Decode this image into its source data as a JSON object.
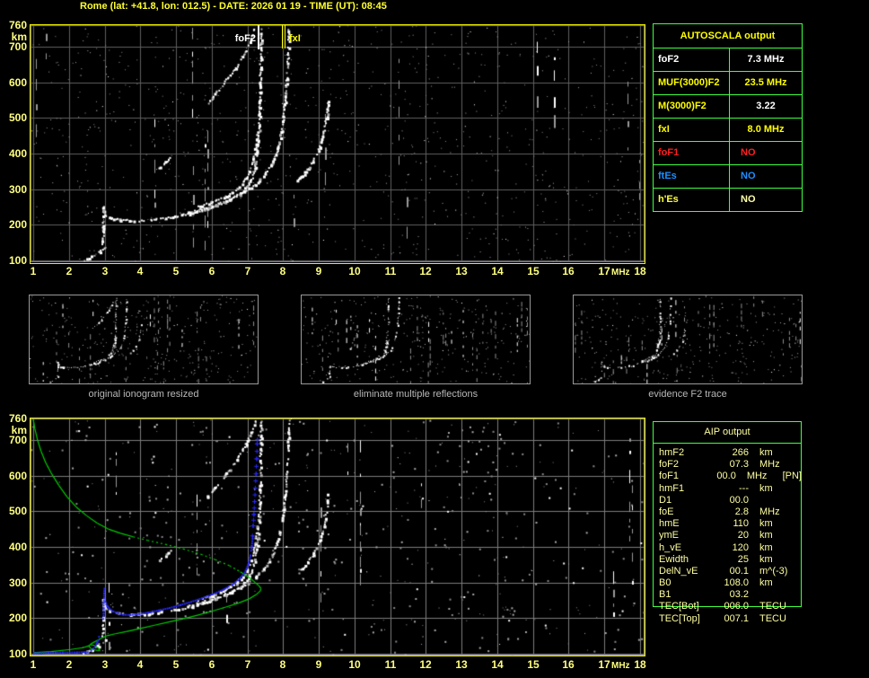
{
  "title": "Rome (lat: +41.8, lon: 012.5) - DATE: 2026 01 19 - TIME (UT): 08:45",
  "colors": {
    "plot_border": "#f0f000",
    "table_border": "#3fff3f",
    "title_text": "#ffff2e",
    "tick_text": "#ffff80",
    "trace_white": "#ffffff",
    "profile_green": "#00cc00",
    "fitted_blue": "#2828ff",
    "status_red": "#ff2020",
    "status_blue": "#1e8fff",
    "pale_yellow": "#ffffa0",
    "caption_gray": "#b8b8b8"
  },
  "top_plot": {
    "y_unit": "km",
    "x_unit": "MHz",
    "y_ticks": [
      760,
      700,
      600,
      500,
      400,
      300,
      200,
      100
    ],
    "x_ticks": [
      "1",
      "2",
      "3",
      "4",
      "5",
      "6",
      "7",
      "8",
      "9",
      "10",
      "11",
      "12",
      "13",
      "14",
      "15",
      "16",
      "17",
      "18"
    ],
    "foF2_label": "foF2",
    "fxI_label": "fxI"
  },
  "bottom_plot": {
    "y_unit": "km",
    "x_unit": "MHz",
    "y_ticks": [
      760,
      700,
      600,
      500,
      400,
      300,
      200,
      100
    ],
    "x_ticks": [
      "1",
      "2",
      "3",
      "4",
      "5",
      "6",
      "7",
      "8",
      "9",
      "10",
      "11",
      "12",
      "13",
      "14",
      "15",
      "16",
      "17",
      "18"
    ]
  },
  "thumbnails": [
    {
      "caption": "original ionogram resized",
      "exclude": []
    },
    {
      "caption": "eliminate multiple reflections",
      "exclude": [
        "second-hop-2F-echo",
        "x-second-echo"
      ]
    },
    {
      "caption": "evidence F2 trace",
      "exclude": [
        "second-hop-2F-echo",
        "high-dash"
      ]
    }
  ],
  "autoscala_table": {
    "title": "AUTOSCALA output",
    "rows": [
      {
        "label": "foF2",
        "value": "7.3 MHz",
        "label_color": "#ffffff",
        "value_color": "#ffffff"
      },
      {
        "label": "MUF(3000)F2",
        "value": "23.5 MHz",
        "label_color": "#ffff00",
        "value_color": "#ffff00"
      },
      {
        "label": "M(3000)F2",
        "value": "3.22",
        "label_color": "#ffff00",
        "value_color": "#ffffff"
      },
      {
        "label": "fxI",
        "value": "8.0 MHz",
        "label_color": "#ffff00",
        "value_color": "#ffff00"
      },
      {
        "label": "foF1",
        "value": "NO",
        "label_color": "#ff2020",
        "value_color": "#ff2020"
      },
      {
        "label": "ftEs",
        "value": "NO",
        "label_color": "#1e8fff",
        "value_color": "#1e8fff"
      },
      {
        "label": "h'Es",
        "value": "NO",
        "label_color": "#ffff40",
        "value_color": "#ffffa8"
      }
    ]
  },
  "aip_table": {
    "title": "AIP output",
    "rows": [
      {
        "name": "hmF2",
        "value": "266",
        "unit": "km",
        "extra": ""
      },
      {
        "name": "foF2",
        "value": "07.3",
        "unit": "MHz",
        "extra": ""
      },
      {
        "name": "foF1",
        "value": "00.0",
        "unit": "MHz",
        "extra": "[PN]"
      },
      {
        "name": "hmF1",
        "value": "---",
        "unit": "km",
        "extra": ""
      },
      {
        "name": "D1",
        "value": "00.0",
        "unit": "",
        "extra": ""
      },
      {
        "name": "foE",
        "value": "2.8",
        "unit": "MHz",
        "extra": ""
      },
      {
        "name": "hmE",
        "value": "110",
        "unit": "km",
        "extra": ""
      },
      {
        "name": "ymE",
        "value": "20",
        "unit": "km",
        "extra": ""
      },
      {
        "name": "h_vE",
        "value": "120",
        "unit": "km",
        "extra": ""
      },
      {
        "name": "Ewidth",
        "value": "25",
        "unit": "km",
        "extra": ""
      },
      {
        "name": "DelN_vE",
        "value": "00.1",
        "unit": "m^(-3)",
        "extra": ""
      },
      {
        "name": "B0",
        "value": "108.0",
        "unit": "km",
        "extra": ""
      },
      {
        "name": "B1",
        "value": "03.2",
        "unit": "",
        "extra": ""
      },
      {
        "name": "TEC[Bot]",
        "value": "006.0",
        "unit": "TECU",
        "extra": ""
      },
      {
        "name": "TEC[Top]",
        "value": "007.1",
        "unit": "TECU",
        "extra": ""
      }
    ]
  },
  "chart_data": {
    "type": "scatter",
    "x_unit": "MHz",
    "y_unit": "km",
    "xlim": [
      1,
      18
    ],
    "ylim": [
      100,
      760
    ],
    "grid": true,
    "top_markers": [
      {
        "name": "foF2",
        "freq_mhz": 7.3,
        "color": "#ffffff"
      },
      {
        "name": "fxI",
        "freq_mhz": 8.0,
        "color": "#ffff00"
      }
    ],
    "ionogram_traces": [
      {
        "name": "F2-o-mode",
        "points": [
          [
            2.94,
            256
          ],
          [
            2.96,
            238
          ],
          [
            3.0,
            228
          ],
          [
            3.15,
            221
          ],
          [
            3.4,
            216
          ],
          [
            3.7,
            213
          ],
          [
            4.0,
            213
          ],
          [
            4.3,
            215
          ],
          [
            4.7,
            220
          ],
          [
            5.0,
            226
          ],
          [
            5.4,
            234
          ],
          [
            5.8,
            245
          ],
          [
            6.2,
            259
          ],
          [
            6.5,
            272
          ],
          [
            6.8,
            290
          ],
          [
            7.0,
            310
          ],
          [
            7.12,
            335
          ],
          [
            7.2,
            365
          ],
          [
            7.26,
            405
          ],
          [
            7.3,
            455
          ],
          [
            7.32,
            510
          ],
          [
            7.34,
            575
          ],
          [
            7.35,
            640
          ],
          [
            7.36,
            700
          ],
          [
            7.36,
            755
          ]
        ]
      },
      {
        "name": "leading-edge-spread",
        "points": [
          [
            2.93,
            148
          ],
          [
            2.94,
            185
          ],
          [
            2.94,
            222
          ],
          [
            2.95,
            252
          ]
        ]
      },
      {
        "name": "F2-o-spread",
        "points": [
          [
            5.6,
            252
          ],
          [
            6.0,
            266
          ],
          [
            6.4,
            283
          ],
          [
            6.7,
            302
          ],
          [
            6.9,
            324
          ],
          [
            7.05,
            352
          ],
          [
            7.15,
            386
          ],
          [
            7.22,
            424
          ],
          [
            7.28,
            462
          ]
        ]
      },
      {
        "name": "F2-x-mode",
        "points": [
          [
            5.3,
            236
          ],
          [
            5.7,
            246
          ],
          [
            6.1,
            258
          ],
          [
            6.5,
            274
          ],
          [
            6.9,
            294
          ],
          [
            7.2,
            315
          ],
          [
            7.45,
            340
          ],
          [
            7.65,
            370
          ],
          [
            7.8,
            405
          ],
          [
            7.9,
            445
          ],
          [
            7.98,
            492
          ],
          [
            8.04,
            548
          ],
          [
            8.08,
            610
          ],
          [
            8.12,
            672
          ],
          [
            8.14,
            730
          ],
          [
            8.15,
            756
          ]
        ]
      },
      {
        "name": "second-hop-2F-echo",
        "points": [
          [
            5.85,
            540
          ],
          [
            6.1,
            572
          ],
          [
            6.4,
            608
          ],
          [
            6.7,
            648
          ],
          [
            6.95,
            690
          ],
          [
            7.1,
            726
          ],
          [
            7.2,
            756
          ]
        ]
      },
      {
        "name": "low-E-trace",
        "points": [
          [
            2.35,
            100
          ],
          [
            2.55,
            109
          ],
          [
            2.8,
            124
          ],
          [
            3.0,
            140
          ]
        ]
      },
      {
        "name": "x-second-echo",
        "points": [
          [
            8.35,
            322
          ],
          [
            8.6,
            348
          ],
          [
            8.82,
            380
          ],
          [
            9.0,
            418
          ],
          [
            9.12,
            458
          ],
          [
            9.2,
            502
          ],
          [
            9.25,
            548
          ]
        ]
      },
      {
        "name": "high-dash",
        "points": [
          [
            4.5,
            362
          ],
          [
            4.7,
            377
          ],
          [
            4.82,
            390
          ]
        ]
      }
    ],
    "bottom_overlays": {
      "electron_density_profile": {
        "color": "#00cc00",
        "points": [
          [
            1.0,
            758
          ],
          [
            1.05,
            730
          ],
          [
            1.12,
            700
          ],
          [
            1.22,
            668
          ],
          [
            1.35,
            636
          ],
          [
            1.52,
            604
          ],
          [
            1.72,
            572
          ],
          [
            1.95,
            540
          ],
          [
            2.2,
            512
          ],
          [
            2.5,
            487
          ],
          [
            2.8,
            466
          ],
          [
            3.1,
            450
          ],
          [
            3.45,
            438
          ],
          [
            3.8,
            428
          ],
          [
            4.2,
            418
          ],
          [
            4.7,
            407
          ],
          [
            5.2,
            394
          ],
          [
            5.7,
            379
          ],
          [
            6.1,
            364
          ],
          [
            6.5,
            347
          ],
          [
            6.8,
            330
          ],
          [
            7.05,
            314
          ],
          [
            7.22,
            300
          ],
          [
            7.33,
            290
          ],
          [
            7.38,
            283
          ],
          [
            7.36,
            276
          ],
          [
            7.25,
            266
          ],
          [
            7.05,
            254
          ],
          [
            6.75,
            242
          ],
          [
            6.4,
            231
          ],
          [
            6.0,
            219
          ],
          [
            5.6,
            208
          ],
          [
            5.2,
            198
          ],
          [
            4.8,
            189
          ],
          [
            4.4,
            180
          ],
          [
            4.0,
            171
          ],
          [
            3.6,
            162
          ],
          [
            3.3,
            156
          ],
          [
            3.05,
            150
          ],
          [
            2.9,
            143
          ],
          [
            2.75,
            135
          ],
          [
            2.62,
            128
          ],
          [
            2.56,
            121
          ],
          [
            2.62,
            114
          ],
          [
            2.75,
            110
          ],
          [
            2.87,
            109
          ],
          [
            2.83,
            116
          ],
          [
            2.74,
            122
          ],
          [
            2.6,
            126
          ]
        ]
      },
      "profile_foot": {
        "color": "#00cc00",
        "points": [
          [
            1.0,
            103
          ],
          [
            1.5,
            106
          ],
          [
            2.05,
            112
          ],
          [
            2.4,
            117
          ],
          [
            2.58,
            123
          ]
        ]
      },
      "fitted_trace": {
        "color": "#2828ff",
        "segments": [
          [
            [
              1.0,
              104
            ],
            [
              1.2,
              104
            ],
            [
              1.4,
              105
            ],
            [
              1.6,
              105
            ],
            [
              1.8,
              106
            ],
            [
              2.0,
              106
            ],
            [
              2.2,
              106
            ],
            [
              2.4,
              107
            ],
            [
              2.5,
              107
            ]
          ],
          [
            [
              2.6,
              111
            ],
            [
              2.66,
              117
            ],
            [
              2.71,
              124
            ],
            [
              2.75,
              131
            ],
            [
              2.79,
              140
            ],
            [
              2.82,
              150
            ]
          ],
          [
            [
              2.94,
              200
            ],
            [
              2.95,
              215
            ],
            [
              2.95,
              230
            ],
            [
              2.95,
              245
            ],
            [
              2.96,
              258
            ],
            [
              2.96,
              272
            ],
            [
              2.97,
              285
            ]
          ],
          [
            [
              3.0,
              248
            ],
            [
              3.05,
              236
            ],
            [
              3.12,
              228
            ],
            [
              3.22,
              221
            ],
            [
              3.35,
              216
            ],
            [
              3.5,
              212
            ],
            [
              3.7,
              211
            ],
            [
              3.95,
              214
            ],
            [
              4.2,
              218
            ],
            [
              4.5,
              224
            ],
            [
              4.8,
              231
            ],
            [
              5.1,
              239
            ],
            [
              5.4,
              248
            ],
            [
              5.7,
              258
            ],
            [
              6.0,
              269
            ],
            [
              6.3,
              282
            ],
            [
              6.55,
              296
            ],
            [
              6.75,
              312
            ],
            [
              6.9,
              330
            ],
            [
              7.0,
              352
            ],
            [
              7.06,
              378
            ],
            [
              7.1,
              405
            ],
            [
              7.13,
              432
            ],
            [
              7.15,
              460
            ],
            [
              7.17,
              492
            ],
            [
              7.19,
              528
            ],
            [
              7.21,
              566
            ],
            [
              7.23,
              606
            ],
            [
              7.25,
              648
            ],
            [
              7.26,
              690
            ],
            [
              7.27,
              702
            ]
          ]
        ]
      }
    }
  }
}
